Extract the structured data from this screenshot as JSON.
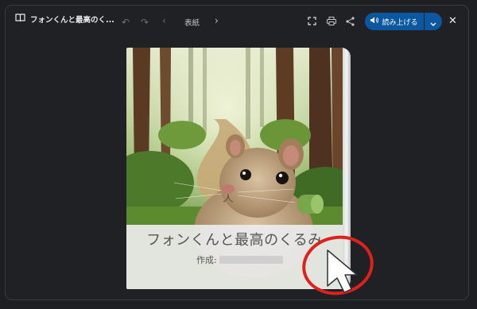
{
  "toolbar": {
    "doc_title": "フォンくんと最高のく...",
    "page_label": "表紙",
    "read_aloud_label": "読み上げる"
  },
  "book": {
    "title": "フォンくんと最高のくるみ",
    "author_label": "作成:"
  },
  "colors": {
    "accent": "#0b57a0",
    "annotation": "#e0201c"
  },
  "icons": [
    "book-icon",
    "undo-icon",
    "redo-icon",
    "prev-page-icon",
    "next-page-icon",
    "fullscreen-icon",
    "print-icon",
    "share-icon",
    "speaker-icon",
    "chevron-down-icon",
    "close-icon"
  ]
}
